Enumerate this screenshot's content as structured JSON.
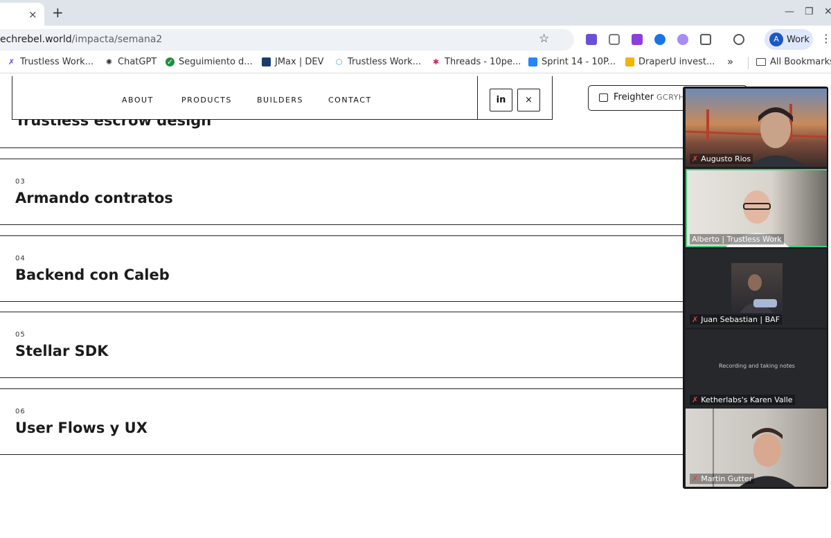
{
  "browser": {
    "tab_close": "×",
    "new_tab": "+",
    "window_controls": [
      "—",
      "❐",
      "✕"
    ],
    "url_host": "echrebel.world",
    "url_path": "/impacta/semana2",
    "star": "☆",
    "profile_initial": "A",
    "profile_label": "Work",
    "menu": "⋮",
    "bookmarks": [
      {
        "label": "Trustless Work...",
        "icon": "x-logo-icon",
        "color": "#5b4bd6"
      },
      {
        "label": "ChatGPT",
        "icon": "chatgpt-icon",
        "color": "#333333"
      },
      {
        "label": "Seguimiento d...",
        "icon": "check-circle-icon",
        "color": "#1e8e3e"
      },
      {
        "label": "JMax | DEV",
        "icon": "jmax-icon",
        "color": "#1a3d6d"
      },
      {
        "label": "Trustless Work...",
        "icon": "hexagon-icon",
        "color": "#4aa3df"
      },
      {
        "label": "Threads - 10pe...",
        "icon": "slack-icon",
        "color": "#e01e5a"
      },
      {
        "label": "Sprint 14 - 10P...",
        "icon": "jira-icon",
        "color": "#2684ff"
      },
      {
        "label": "DraperU invest...",
        "icon": "slides-icon",
        "color": "#f4b400"
      }
    ],
    "more_bookmarks": "»",
    "all_bookmarks": "All Bookmarks"
  },
  "site": {
    "nav": [
      "ABOUT",
      "PRODUCTS",
      "BUILDERS",
      "CONTACT"
    ],
    "linkedin": "in",
    "x_social": "×",
    "freighter_label": "Freighter",
    "freighter_addr": "GCRYH"
  },
  "lessons": {
    "partial_title": "Trustless escrow design",
    "items": [
      {
        "num": "03",
        "title": "Armando contratos"
      },
      {
        "num": "04",
        "title": "Backend con Caleb"
      },
      {
        "num": "05",
        "title": "Stellar SDK"
      },
      {
        "num": "06",
        "title": "User Flows y UX"
      }
    ]
  },
  "call": {
    "participants": [
      {
        "name": "Augusto Rios"
      },
      {
        "name": "Alberto | Trustless Work"
      },
      {
        "name": "Juan Sebastian | BAF"
      },
      {
        "name": "Ketherlabs's Karen Valle"
      },
      {
        "name": "Martin Gutter"
      }
    ],
    "recording_note": "Recording and taking notes"
  }
}
